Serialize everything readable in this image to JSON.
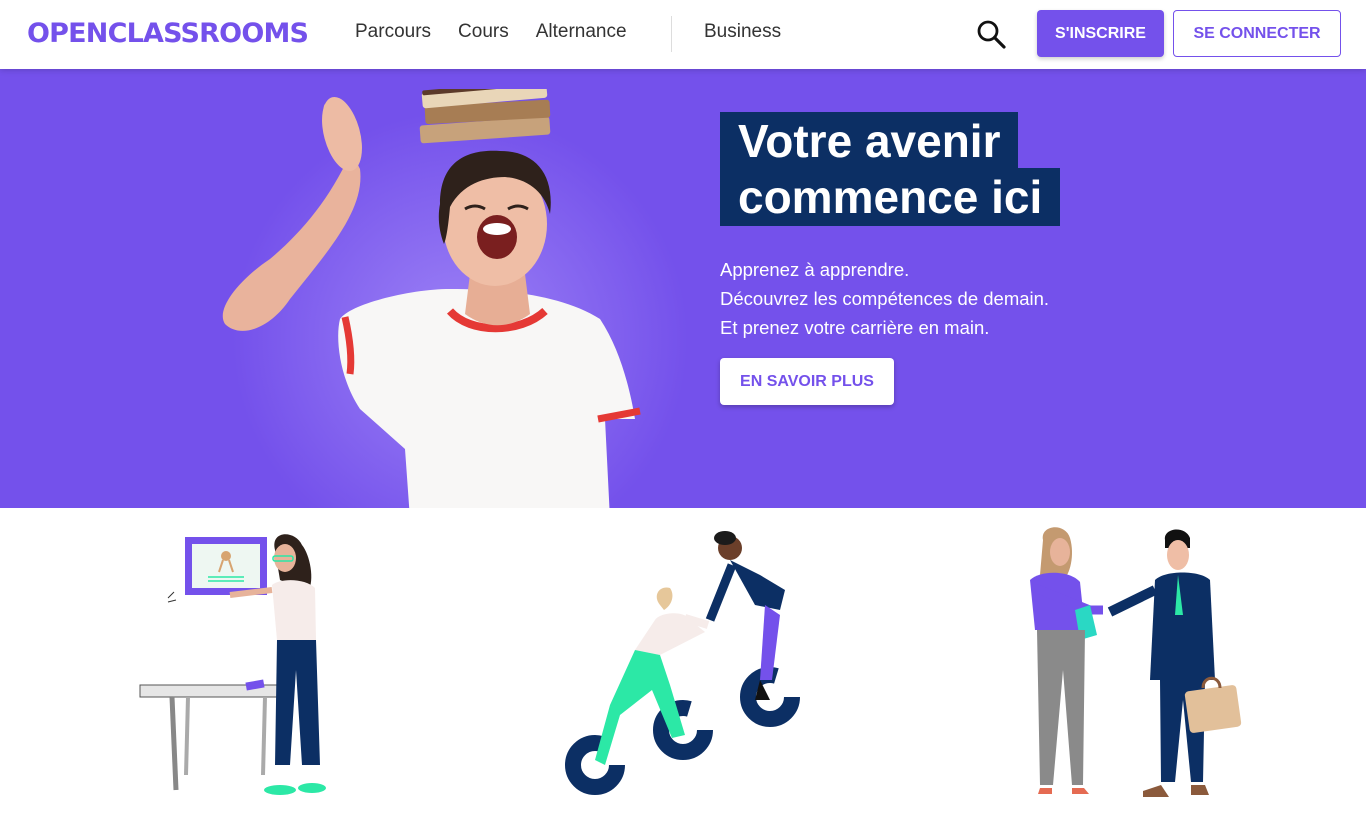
{
  "header": {
    "logo_text": "OPENCLASSROOMS",
    "nav": [
      "Parcours",
      "Cours",
      "Alternance"
    ],
    "business_label": "Business",
    "search_icon": "search-icon",
    "signup_label": "S'INSCRIRE",
    "login_label": "SE CONNECTER"
  },
  "hero": {
    "title_line1": "Votre avenir",
    "title_line2": "commence ici",
    "subtitle_lines": [
      "Apprenez à apprendre.",
      "Découvrez les compétences de demain.",
      "Et prenez votre carrière en main."
    ],
    "cta_label": "EN SAVOIR PLUS"
  },
  "colors": {
    "brand": "#7451eb",
    "title_bg": "#0c2f64",
    "accent_green": "#2ce8a6"
  },
  "illustrations": [
    "diploma-woman-illustration",
    "helping-hand-illustration",
    "handshake-illustration"
  ]
}
